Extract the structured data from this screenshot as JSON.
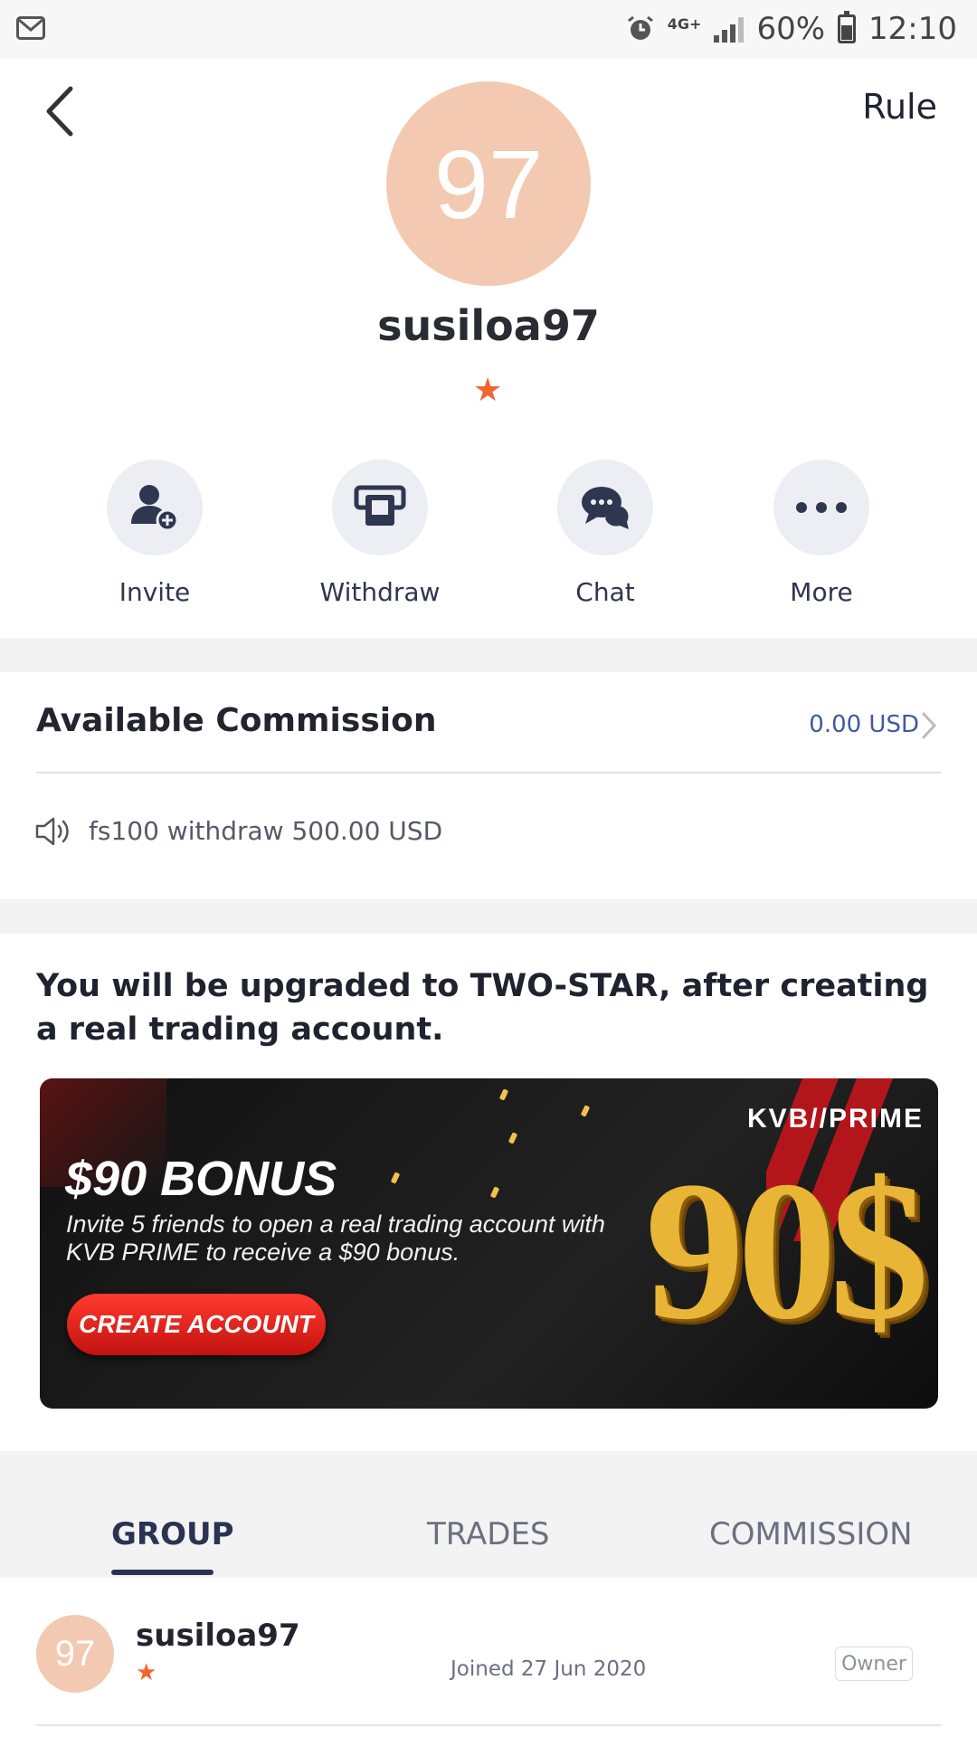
{
  "status_bar": {
    "network": "4G+",
    "battery": "60%",
    "time": "12:10"
  },
  "header": {
    "rule_label": "Rule",
    "avatar_initials": "97",
    "username": "susiloa97",
    "star_rating": 1
  },
  "actions": [
    {
      "label": "Invite",
      "icon": "invite-user-icon"
    },
    {
      "label": "Withdraw",
      "icon": "withdraw-icon"
    },
    {
      "label": "Chat",
      "icon": "chat-icon"
    },
    {
      "label": "More",
      "icon": "more-icon"
    }
  ],
  "commission": {
    "title": "Available Commission",
    "value": "0.00 USD",
    "notice": "fs100 withdraw 500.00 USD"
  },
  "upgrade": {
    "text": "You will be upgraded to TWO-STAR, after creating a real trading account."
  },
  "banner": {
    "brand": "KVB//PRIME",
    "headline": "$90 BONUS",
    "description": "Invite 5 friends to open a real trading account with KVB PRIME to receive a $90 bonus.",
    "cta": "CREATE ACCOUNT",
    "big_text": "90$",
    "colors": {
      "gold": "#e8b536",
      "cta_red": "#d71a14"
    }
  },
  "tabs": [
    {
      "label": "GROUP",
      "active": true
    },
    {
      "label": "TRADES",
      "active": false
    },
    {
      "label": "COMMISSION",
      "active": false
    }
  ],
  "members": [
    {
      "initials": "97",
      "name": "susiloa97",
      "joined": "Joined 27 Jun 2020",
      "role": "Owner",
      "stars": 1
    }
  ],
  "colors": {
    "avatar": "#f3c9b2",
    "star": "#f26430",
    "accent_text": "#3f5aa0",
    "tab_active": "#2a3352"
  }
}
